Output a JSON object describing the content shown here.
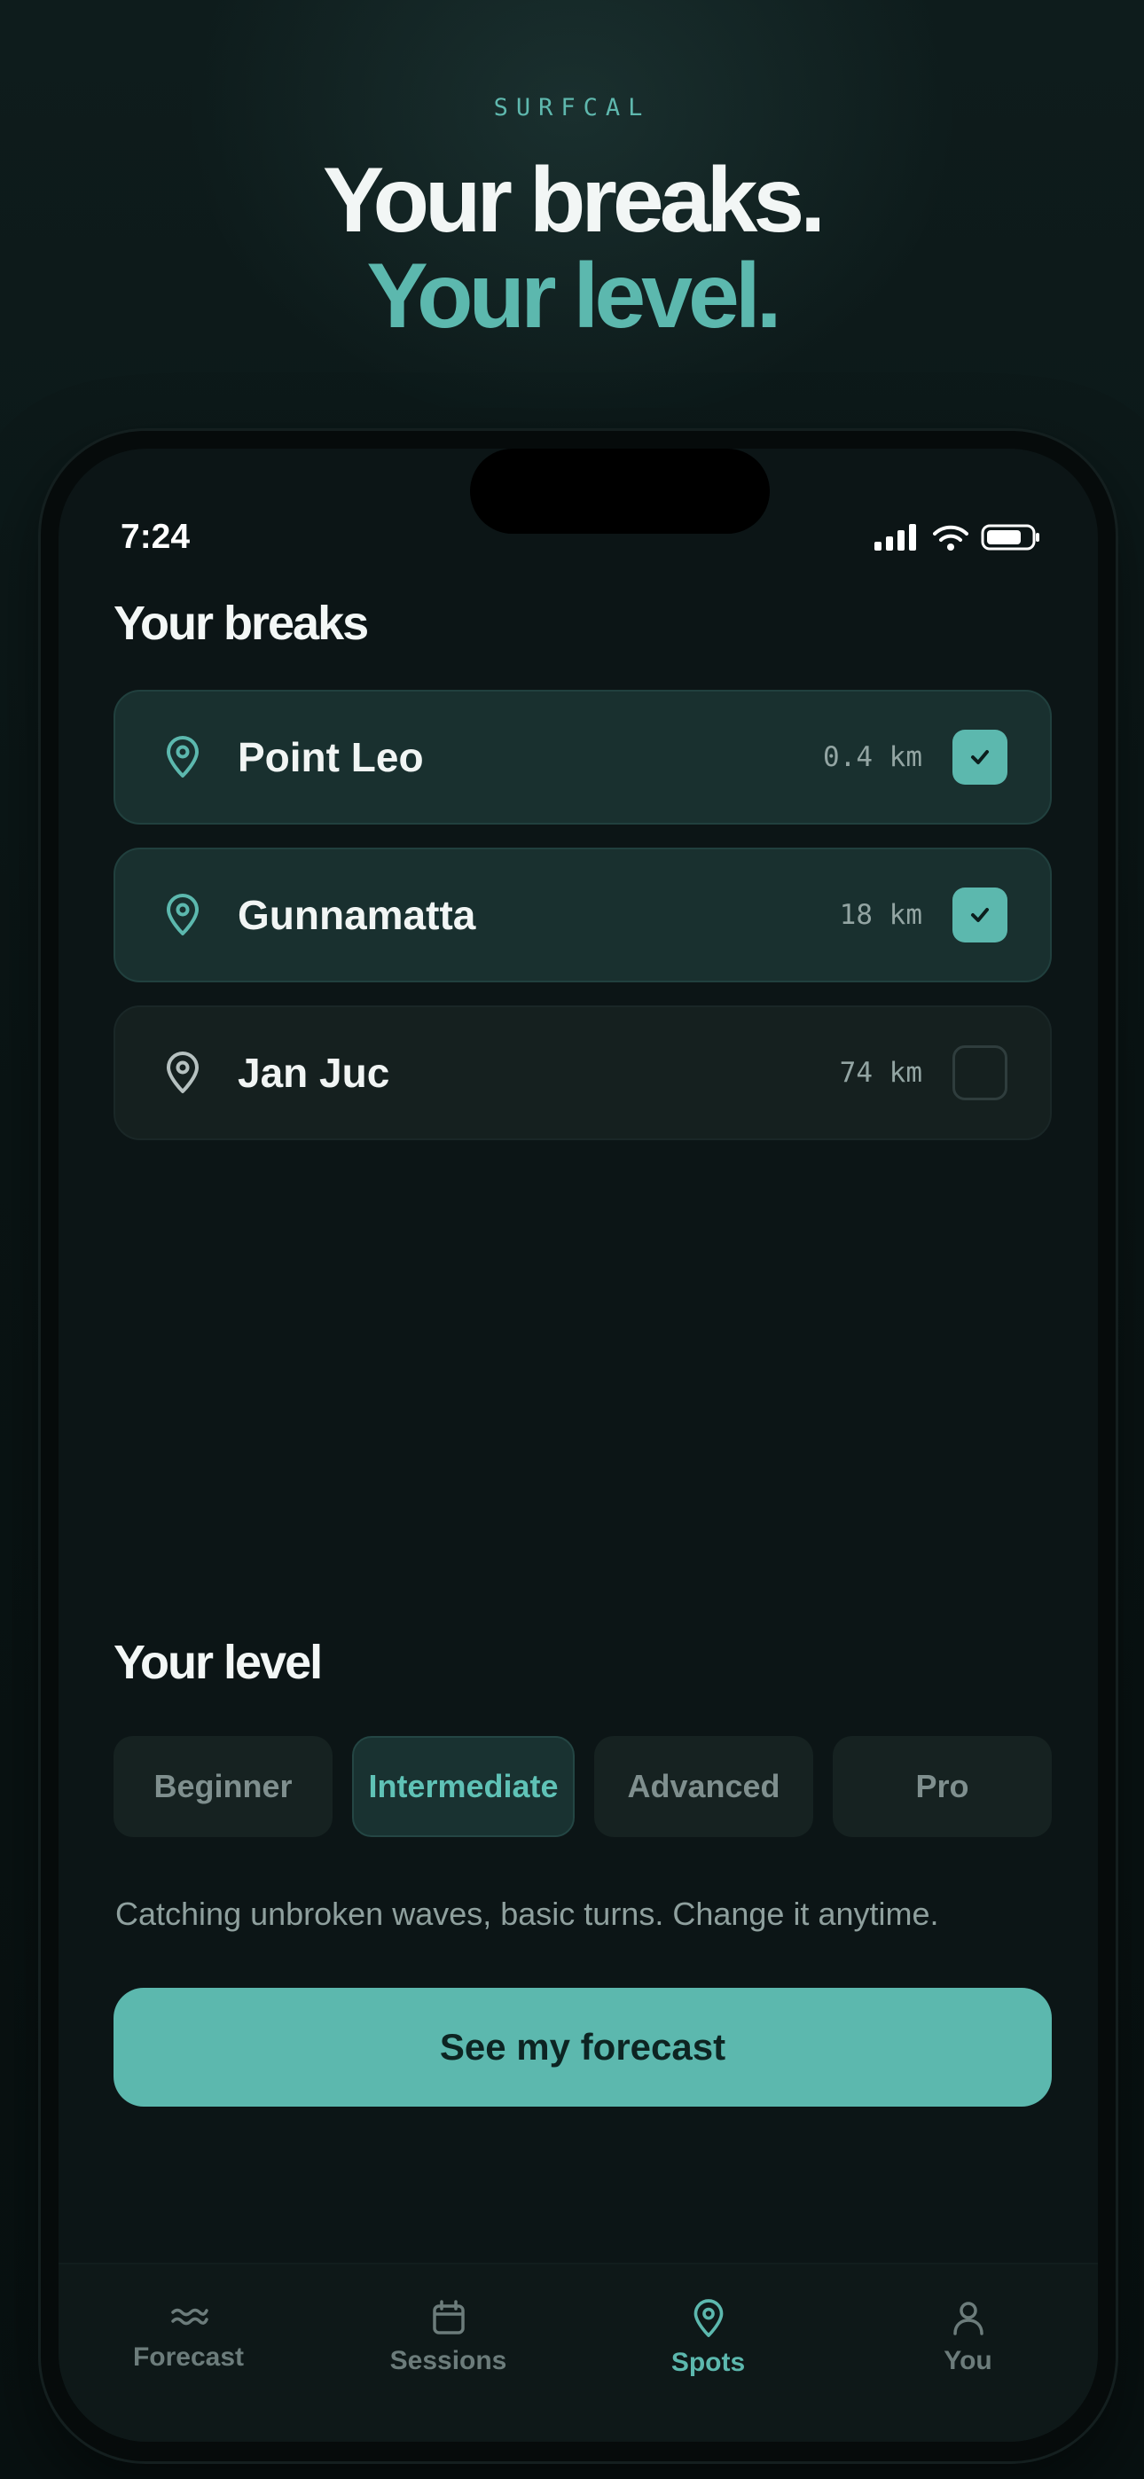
{
  "brand": "SURFCAL",
  "hero": {
    "line1": "Your breaks.",
    "line2": "Your level."
  },
  "status": {
    "time": "7:24",
    "icons": [
      "signal-icon",
      "wifi-icon",
      "battery-icon"
    ]
  },
  "breaks": {
    "title": "Your breaks",
    "items": [
      {
        "name": "Point Leo",
        "distance": "0.4 km",
        "selected": true
      },
      {
        "name": "Gunnamatta",
        "distance": "18 km",
        "selected": true
      },
      {
        "name": "Jan Juc",
        "distance": "74 km",
        "selected": false
      }
    ]
  },
  "level": {
    "title": "Your level",
    "options": [
      "Beginner",
      "Intermediate",
      "Advanced",
      "Pro"
    ],
    "selected": "Intermediate",
    "hint": "Catching unbroken waves, basic turns. Change it anytime."
  },
  "cta": {
    "label": "See my forecast"
  },
  "tabs": [
    {
      "label": "Forecast",
      "icon": "waves-icon",
      "active": false
    },
    {
      "label": "Sessions",
      "icon": "calendar-icon",
      "active": false
    },
    {
      "label": "Spots",
      "icon": "pin-icon",
      "active": true
    },
    {
      "label": "You",
      "icon": "person-icon",
      "active": false
    }
  ],
  "colors": {
    "accent": "#5cb8ae",
    "background": "#0c1516",
    "card_selected": "#19302f",
    "card": "#15201f"
  }
}
